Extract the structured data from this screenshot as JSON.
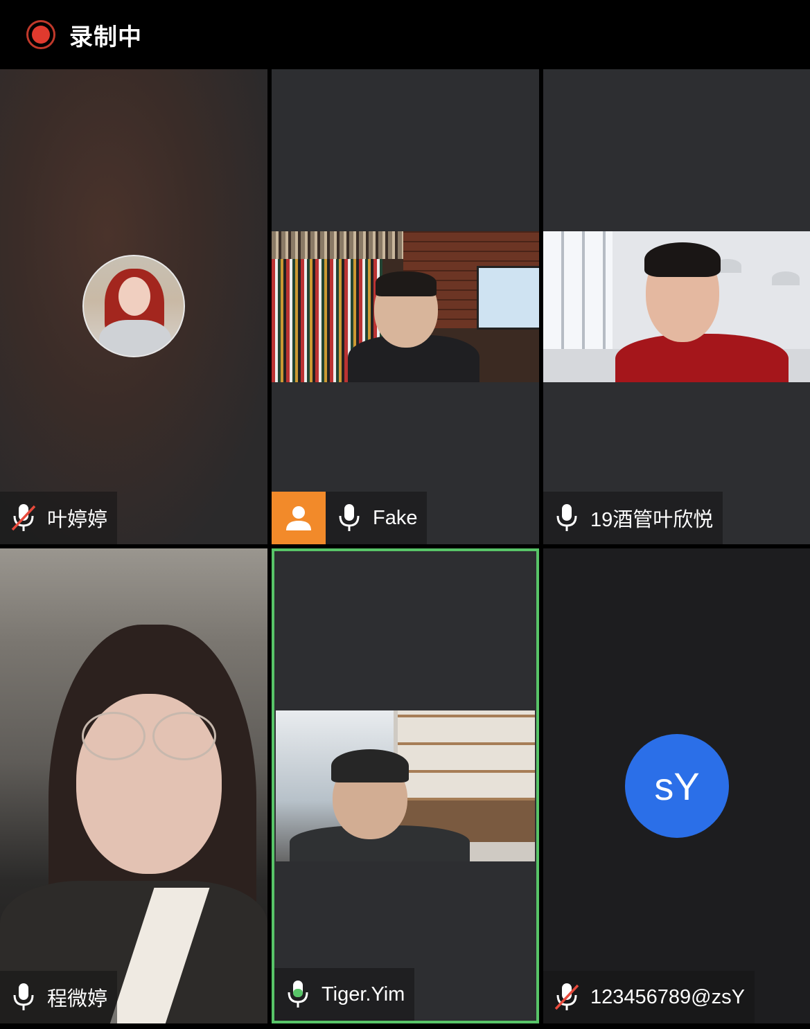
{
  "header": {
    "recording_label": "录制中"
  },
  "participants": [
    {
      "name": "叶婷婷",
      "mic": "muted",
      "display": "avatar"
    },
    {
      "name": "Fake",
      "mic": "on",
      "display": "video"
    },
    {
      "name": "19酒管叶欣悦",
      "mic": "on",
      "display": "video"
    },
    {
      "name": "程微婷",
      "mic": "on",
      "display": "video"
    },
    {
      "name": "Tiger.Yim",
      "mic": "speaking",
      "display": "video",
      "active_speaker": true
    },
    {
      "name": "123456789@zsY",
      "mic": "muted",
      "display": "initials",
      "initials": "sY"
    }
  ],
  "colors": {
    "active_border": "#58c468",
    "recording": "#e03a2e",
    "initials_avatar": "#2b6fe8",
    "user_badge": "#f28a2a"
  }
}
